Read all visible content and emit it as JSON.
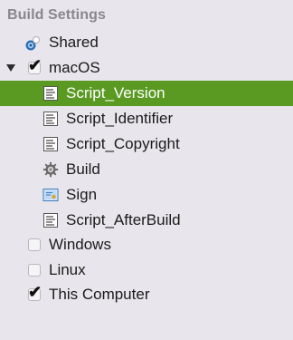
{
  "header": {
    "title": "Build Settings"
  },
  "items": [
    {
      "label": "Shared",
      "icon": "shared-target-icon",
      "checked": false,
      "selected": false
    },
    {
      "label": "macOS",
      "icon": "checkbox",
      "checked": true,
      "expanded": true,
      "selected": false
    },
    {
      "label": "Script_Version",
      "icon": "script-file-icon",
      "selected": true
    },
    {
      "label": "Script_Identifier",
      "icon": "script-file-icon",
      "selected": false
    },
    {
      "label": "Script_Copyright",
      "icon": "script-file-icon",
      "selected": false
    },
    {
      "label": "Build",
      "icon": "gear-icon",
      "selected": false
    },
    {
      "label": "Sign",
      "icon": "certificate-icon",
      "selected": false
    },
    {
      "label": "Script_AfterBuild",
      "icon": "script-file-icon",
      "selected": false
    },
    {
      "label": "Windows",
      "icon": "checkbox",
      "checked": false,
      "selected": false
    },
    {
      "label": "Linux",
      "icon": "checkbox",
      "checked": false,
      "selected": false
    },
    {
      "label": "This Computer",
      "icon": "checkbox",
      "checked": true,
      "selected": false
    }
  ],
  "colors": {
    "selection": "#5a9a22",
    "background": "#e8e6ec",
    "header_text": "#8a878f"
  }
}
